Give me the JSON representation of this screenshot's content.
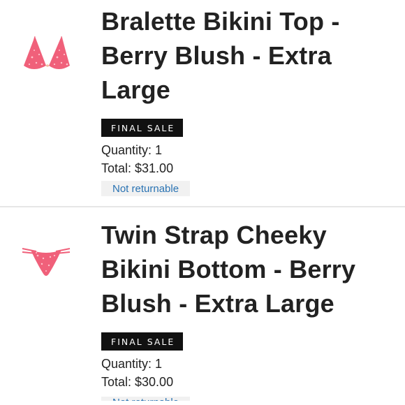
{
  "items": [
    {
      "title": "Bralette Bikini Top - Berry Blush - Extra Large",
      "sale_badge": "FINAL SALE",
      "quantity": "Quantity: 1",
      "total": "Total: $31.00",
      "return_status": "Not returnable",
      "thumbnail_icon": "bikini-top-icon"
    },
    {
      "title": "Twin Strap Cheeky Bikini Bottom - Berry Blush - Extra Large",
      "sale_badge": "FINAL SALE",
      "quantity": "Quantity: 1",
      "total": "Total: $30.00",
      "return_status": "Not returnable",
      "thumbnail_icon": "bikini-bottom-icon"
    }
  ],
  "colors": {
    "product_pink": "#f0607a",
    "badge_black": "#111111",
    "link_blue": "#2a73b3"
  }
}
